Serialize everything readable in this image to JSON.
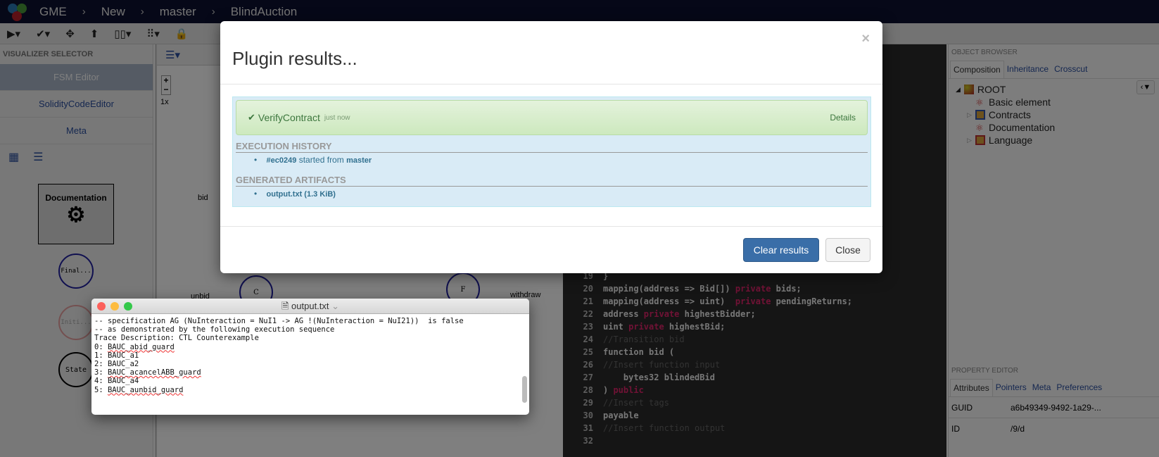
{
  "topbar": {
    "crumbs": [
      "GME",
      "New",
      "master",
      "BlindAuction"
    ]
  },
  "toolbar": {
    "icons": [
      "play-icon",
      "check-circle-icon",
      "move-icon",
      "upload-icon",
      "layout-icon",
      "grid-icon",
      "lock-icon"
    ]
  },
  "left": {
    "title": "VISUALIZER SELECTOR",
    "items": [
      "FSM Editor",
      "SolidityCodeEditor",
      "Meta"
    ]
  },
  "canvas": {
    "zoom": "1x",
    "nodes": [
      "Documentation",
      "Final...",
      "Initi...",
      "State",
      "C",
      "F"
    ],
    "labels": [
      "bid",
      "unbid",
      "withdraw"
    ]
  },
  "code": {
    "lines": [
      {
        "n": "19",
        "t": "}"
      },
      {
        "n": "20",
        "t": "mapping(address => Bid[]) ",
        "k": "private",
        "r": " bids;"
      },
      {
        "n": "21",
        "t": "mapping(address => uint)  ",
        "k": "private",
        "r": " pendingReturns;"
      },
      {
        "n": "22",
        "t": "address ",
        "k": "private",
        "r": " highestBidder;"
      },
      {
        "n": "23",
        "t": "uint ",
        "k": "private",
        "r": " highestBid;"
      },
      {
        "n": "24",
        "c": "//Transition bid"
      },
      {
        "n": "25",
        "t": "function bid ("
      },
      {
        "n": "26",
        "c": "//Insert function input"
      },
      {
        "n": "27",
        "t": "    bytes32 blindedBid"
      },
      {
        "n": "28",
        "t": ") ",
        "k": "public"
      },
      {
        "n": "29",
        "c": "//Insert tags"
      },
      {
        "n": "30",
        "t": "payable"
      },
      {
        "n": "31",
        "c": "//Insert function output"
      },
      {
        "n": "32",
        "t": ""
      }
    ]
  },
  "object_browser": {
    "title": "OBJECT BROWSER",
    "tabs": [
      "Composition",
      "Inheritance",
      "Crosscut"
    ],
    "tree": [
      "ROOT",
      "Basic element",
      "Contracts",
      "Documentation",
      "Language"
    ]
  },
  "property_editor": {
    "title": "PROPERTY EDITOR",
    "tabs": [
      "Attributes",
      "Pointers",
      "Meta",
      "Preferences"
    ],
    "rows": [
      {
        "k": "GUID",
        "v": "a6b49349-9492-1a29-..."
      },
      {
        "k": "ID",
        "v": "/9/d"
      }
    ]
  },
  "modal": {
    "title": "Plugin results...",
    "close_x": "×",
    "plugin": "VerifyContract",
    "time": "just now",
    "details": "Details",
    "history_title": "EXECUTION HISTORY",
    "history_id": "#ec0249",
    "history_text": " started from ",
    "history_branch": "master",
    "artifacts_title": "GENERATED ARTIFACTS",
    "artifact": "output.txt (1.3 KiB)",
    "clear": "Clear results",
    "close": "Close"
  },
  "output_window": {
    "title": "output.txt",
    "lines": [
      "-- specification AG (NuInteraction = NuI1 -> AG !(NuInteraction = NuI21))  is false",
      "-- as demonstrated by the following execution sequence",
      "Trace Description: CTL Counterexample"
    ],
    "steps": [
      {
        "p": "0: ",
        "s": "BAUC_abid_guard"
      },
      {
        "p": "1: ",
        "s": "BAUC_a1"
      },
      {
        "p": "2: ",
        "s": "BAUC_a2"
      },
      {
        "p": "3: ",
        "s": "BAUC_acancelABB_guard"
      },
      {
        "p": "4: ",
        "s": "BAUC_a4"
      },
      {
        "p": "5: ",
        "s": "BAUC_aunbid_guard"
      }
    ]
  }
}
